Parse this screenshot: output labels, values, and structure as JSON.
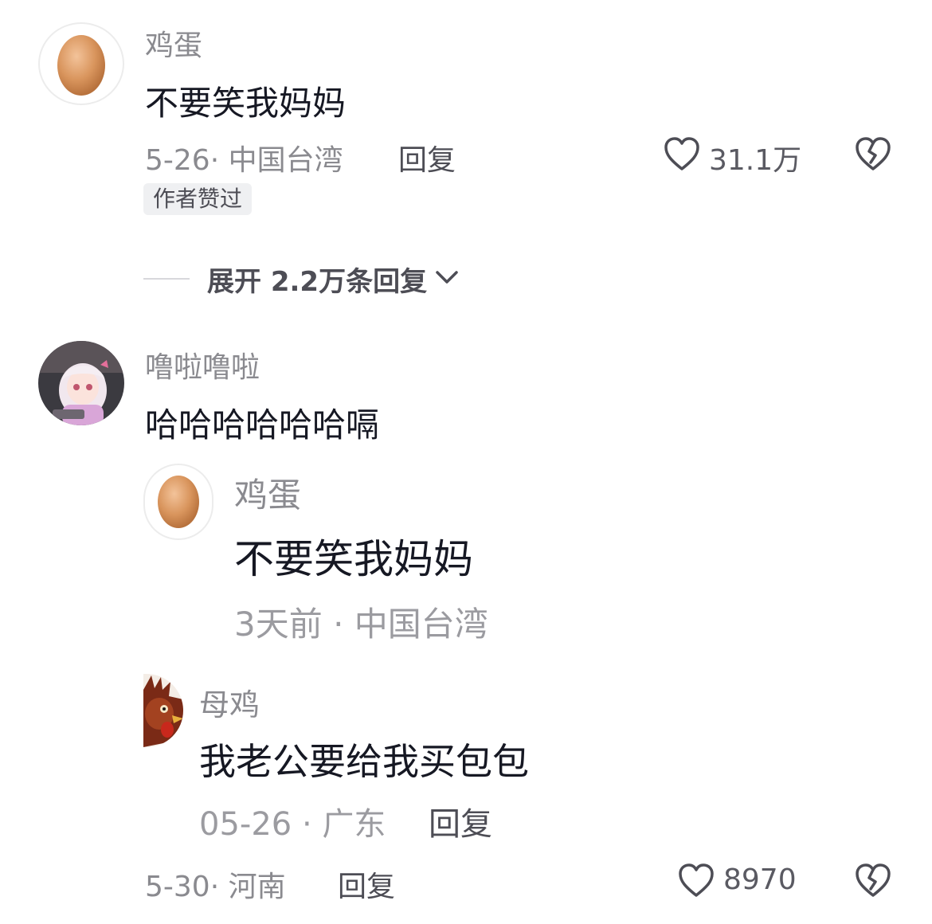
{
  "comments": [
    {
      "username": "鸡蛋",
      "text": "不要笑我妈妈",
      "meta": "5-26· 中国台湾",
      "reply_label": "回复",
      "likes": "31.1万",
      "badge": "作者赞过",
      "avatar": "egg-avatar"
    },
    {
      "username": "噜啦噜啦",
      "text": "哈哈哈哈哈哈嗝",
      "meta": "5-30· 河南",
      "reply_label": "回复",
      "likes": "8970",
      "avatar": "anime-girl-avatar",
      "embedded_image": {
        "comments": [
          {
            "username": "鸡蛋",
            "text": "不要笑我妈妈",
            "meta": "3天前 · 中国台湾",
            "avatar": "egg-avatar"
          },
          {
            "username": "母鸡",
            "text": "我老公要给我买包包",
            "meta": "05-26 · 广东",
            "reply_label": "回复",
            "avatar": "rooster-avatar"
          }
        ]
      }
    }
  ],
  "expand_replies": {
    "label": "展开 2.2万条回复",
    "icon": "chevron-down-icon"
  },
  "icons": {
    "like": "heart-outline-icon",
    "dislike": "broken-heart-icon"
  },
  "colors": {
    "text_primary": "#161823",
    "text_secondary": "#8a8a8f",
    "badge_bg": "#eff0f2"
  }
}
